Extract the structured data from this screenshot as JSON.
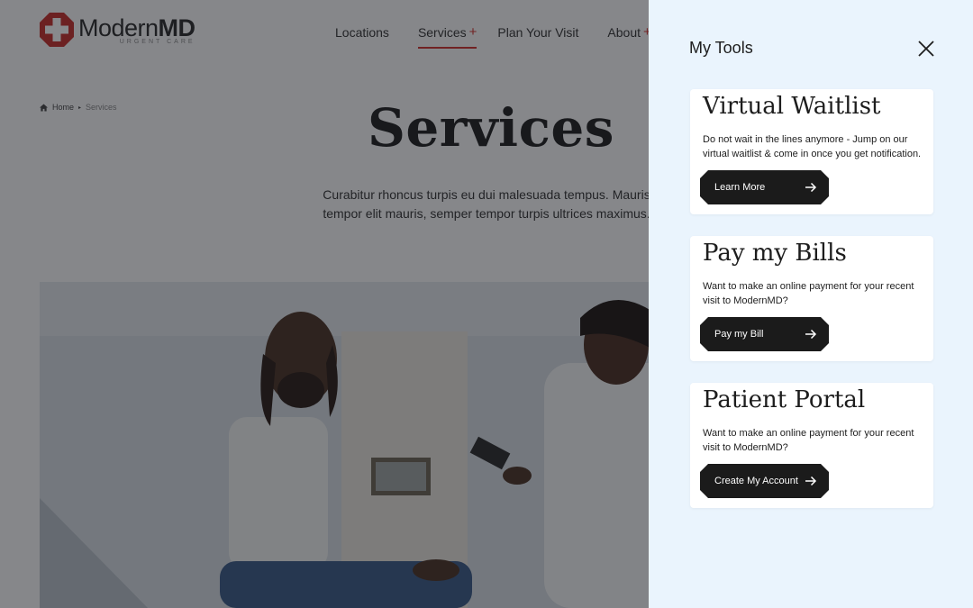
{
  "logo": {
    "brand_regular": "Modern",
    "brand_bold": "MD",
    "tagline": "URGENT CARE"
  },
  "nav": {
    "items": [
      {
        "label": "Locations",
        "has_plus": false,
        "active": false
      },
      {
        "label": "Services",
        "has_plus": true,
        "active": true
      },
      {
        "label": "Plan Your Visit",
        "has_plus": false,
        "active": false
      },
      {
        "label": "About",
        "has_plus": true,
        "active": false
      }
    ],
    "plus_symbol": "+"
  },
  "breadcrumb": {
    "home": "Home",
    "separator": "▸",
    "current": "Services"
  },
  "hero": {
    "title": "Services",
    "description": "Curabitur rhoncus turpis eu dui malesuada tempus. Mauris tempor elit mauris, semper tempor turpis ultrices maximus."
  },
  "drawer": {
    "title": "My Tools",
    "close_icon": "close-icon",
    "cards": [
      {
        "title": "Virtual Waitlist",
        "description": "Do not wait in the lines anymore - Jump on our virtual waitlist & come in once you get notification.",
        "button": "Learn More"
      },
      {
        "title": "Pay my Bills",
        "description": "Want to make an online payment for your recent visit to ModernMD?",
        "button": "Pay my Bill"
      },
      {
        "title": "Patient Portal",
        "description": "Want to make an online payment for your recent visit to ModernMD?",
        "button": "Create My Account"
      }
    ]
  },
  "colors": {
    "accent": "#d0312d",
    "drawer_bg": "#eaf4fd",
    "button_bg": "#1b1b1b",
    "overlay": "rgba(18,20,26,0.5)"
  }
}
